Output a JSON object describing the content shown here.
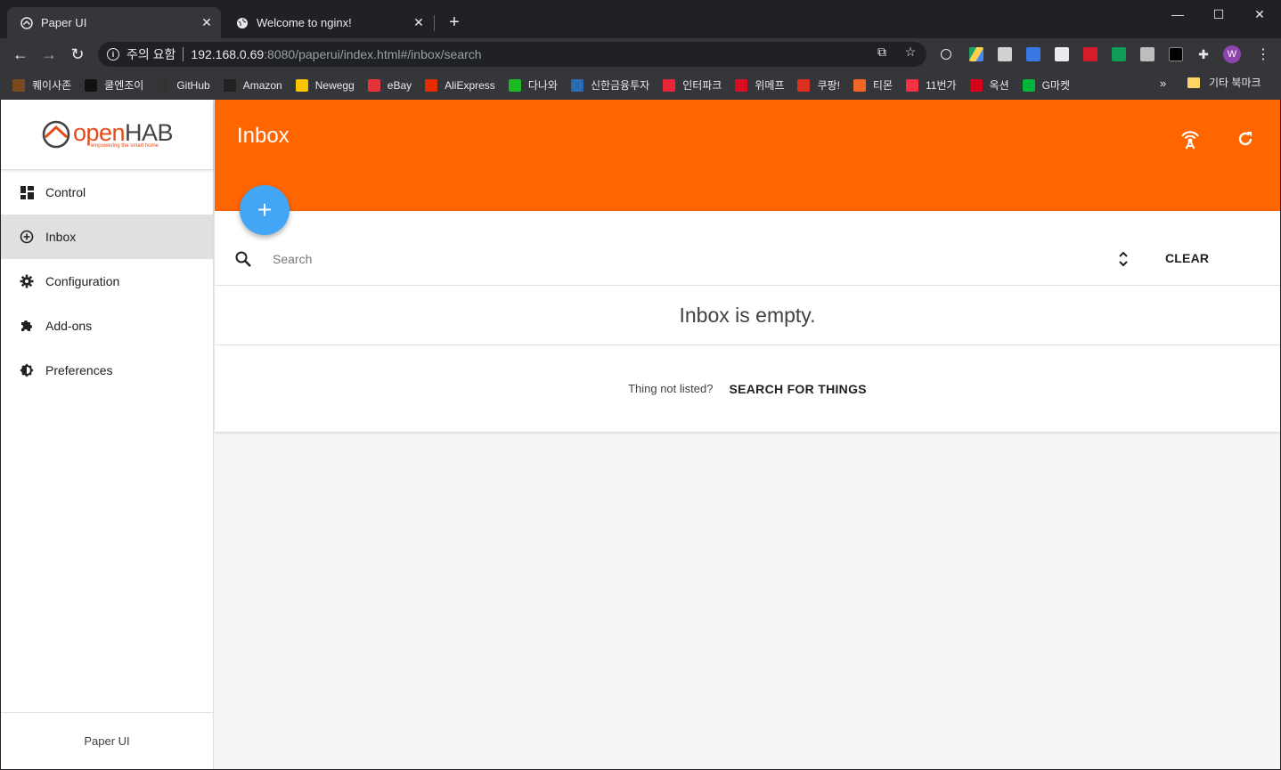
{
  "browser": {
    "tabs": [
      {
        "title": "Paper UI",
        "icon": "openhab-favicon",
        "active": true
      },
      {
        "title": "Welcome to nginx!",
        "icon": "globe-icon",
        "active": false
      }
    ],
    "address": {
      "warning": "주의 요함",
      "host": "192.168.0.69",
      "path": ":8080/paperui/index.html#/inbox/search"
    },
    "profile_initial": "W",
    "bookmarks": [
      {
        "label": "퀘이사존",
        "color": "#7a4a1e"
      },
      {
        "label": "쿨엔조이",
        "color": "#111111"
      },
      {
        "label": "GitHub",
        "color": "#333333"
      },
      {
        "label": "Amazon",
        "color": "#222222"
      },
      {
        "label": "Newegg",
        "color": "#f7c600"
      },
      {
        "label": "eBay",
        "color": "#e53238"
      },
      {
        "label": "AliExpress",
        "color": "#e62e04"
      },
      {
        "label": "다나와",
        "color": "#1db823"
      },
      {
        "label": "신한금융투자",
        "color": "#2d6ab4"
      },
      {
        "label": "인터파크",
        "color": "#e8263a"
      },
      {
        "label": "위메프",
        "color": "#d80f23"
      },
      {
        "label": "쿠팡!",
        "color": "#d9301f"
      },
      {
        "label": "티몬",
        "color": "#f26522"
      },
      {
        "label": "11번가",
        "color": "#f43142"
      },
      {
        "label": "옥션",
        "color": "#d9001b"
      },
      {
        "label": "G마켓",
        "color": "#00b33c"
      }
    ],
    "bookmarks_more": "»",
    "bookmarks_folder": "기타 북마크"
  },
  "app": {
    "logo": {
      "open": "open",
      "hab": "HAB",
      "tagline": "empowering the smart home"
    },
    "nav": [
      {
        "label": "Control",
        "icon": "dashboard-icon"
      },
      {
        "label": "Inbox",
        "icon": "add-circle-icon",
        "selected": true
      },
      {
        "label": "Configuration",
        "icon": "gear-icon"
      },
      {
        "label": "Add-ons",
        "icon": "puzzle-icon"
      },
      {
        "label": "Preferences",
        "icon": "brightness-icon"
      }
    ],
    "footer": "Paper UI",
    "header_title": "Inbox",
    "accent": "#ff6600",
    "fab_color": "#42a5f5",
    "search": {
      "placeholder": "Search",
      "value": "",
      "clear_label": "CLEAR"
    },
    "empty_message": "Inbox is empty.",
    "not_listed": {
      "question": "Thing not listed?",
      "action": "SEARCH FOR THINGS"
    }
  }
}
